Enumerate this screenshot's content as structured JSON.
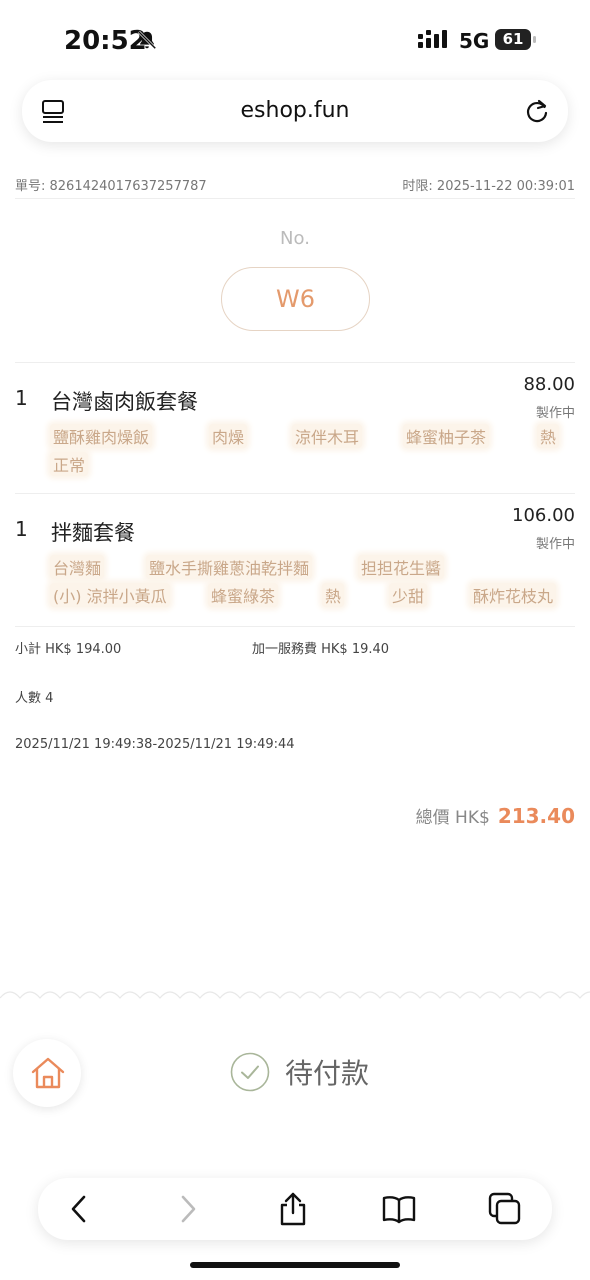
{
  "status_bar": {
    "time": "20:52",
    "network": "5G",
    "battery": "61"
  },
  "browser": {
    "url": "eshop.fun"
  },
  "order": {
    "number_label": "單号: 8261424017637257787",
    "deadline_label": "时限: 2025-11-22 00:39:01",
    "no_label": "No.",
    "table": "W6"
  },
  "items": [
    {
      "qty": "1",
      "name": "台灣鹵肉飯套餐",
      "price": "88.00",
      "status": "製作中",
      "tags": [
        "鹽酥雞肉燥飯",
        "肉燥",
        "涼伴木耳",
        "蜂蜜柚子茶",
        "熱",
        "正常"
      ]
    },
    {
      "qty": "1",
      "name": "拌麵套餐",
      "price": "106.00",
      "status": "製作中",
      "tags": [
        "台灣麵",
        "鹽水手撕雞蔥油乾拌麵",
        "担担花生醬",
        "(小) 涼拌小黃瓜",
        "蜂蜜綠茶",
        "熱",
        "少甜",
        "酥炸花枝丸"
      ]
    }
  ],
  "summary": {
    "subtotal": "小計 HK$ 194.00",
    "service_fee": "加一服務費 HK$ 19.40",
    "people": "人數 4",
    "time_range": "2025/11/21 19:49:38-2025/11/21 19:49:44"
  },
  "total": {
    "label": "總價 HK$",
    "value": "213.40"
  },
  "payment_status": "待付款",
  "colors": {
    "accent": "#ea8a5b",
    "tag_text": "#c9a789",
    "tag_bg": "#fcf4ea"
  },
  "icons": [
    "bell-slash-icon",
    "signal-icon",
    "battery-icon",
    "menu-icon",
    "reload-icon",
    "home-icon",
    "check-circle-icon",
    "back-icon",
    "forward-icon",
    "share-icon",
    "bookmarks-icon",
    "tabs-icon"
  ]
}
